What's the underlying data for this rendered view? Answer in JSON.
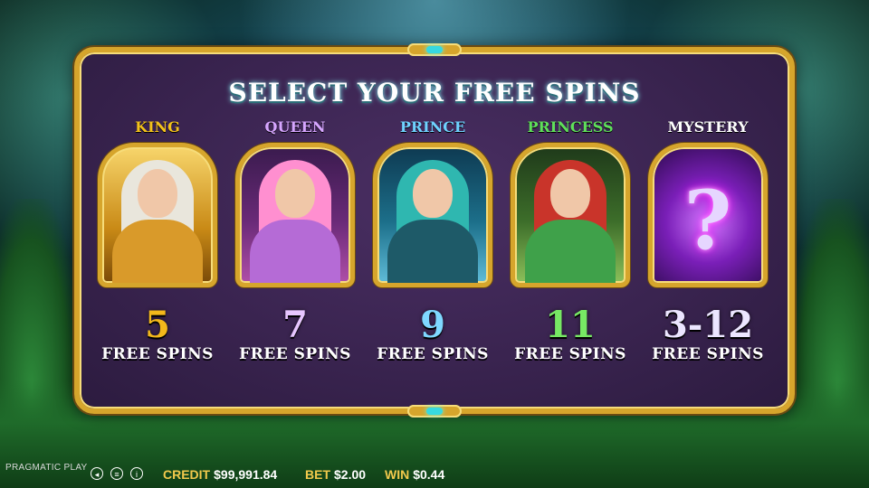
{
  "title": "SELECT YOUR FREE SPINS",
  "cards": [
    {
      "name": "KING",
      "count": "5",
      "label": "FREE SPINS",
      "name_color": "#f3c21b",
      "count_color": "#f3b81b",
      "theme": "gold"
    },
    {
      "name": "QUEEN",
      "count": "7",
      "label": "FREE SPINS",
      "name_color": "#d6a6ff",
      "count_color": "#e7c6ff",
      "theme": "pink"
    },
    {
      "name": "PRINCE",
      "count": "9",
      "label": "FREE SPINS",
      "name_color": "#6fd2ff",
      "count_color": "#7fd8ff",
      "theme": "teal"
    },
    {
      "name": "PRINCESS",
      "count": "11",
      "label": "FREE SPINS",
      "name_color": "#5fe05a",
      "count_color": "#77e864",
      "theme": "green"
    },
    {
      "name": "MYSTERY",
      "count": "3-12",
      "label": "FREE SPINS",
      "name_color": "#ffffff",
      "count_color": "#ece6ff",
      "theme": "purple",
      "icon": "question-mark-icon"
    }
  ],
  "footer": {
    "brand": "PRAGMATIC PLAY",
    "credit_label": "CREDIT",
    "credit_value": "$99,991.84",
    "bet_label": "BET",
    "bet_value": "$2.00",
    "win_label": "WIN",
    "win_value": "$0.44",
    "icons": [
      "sound-icon",
      "menu-icon",
      "info-icon"
    ]
  },
  "colors": {
    "frame_gold": "#d6a52c",
    "panel_purple": "#3a2450",
    "label_yellow": "#f2c94c"
  }
}
